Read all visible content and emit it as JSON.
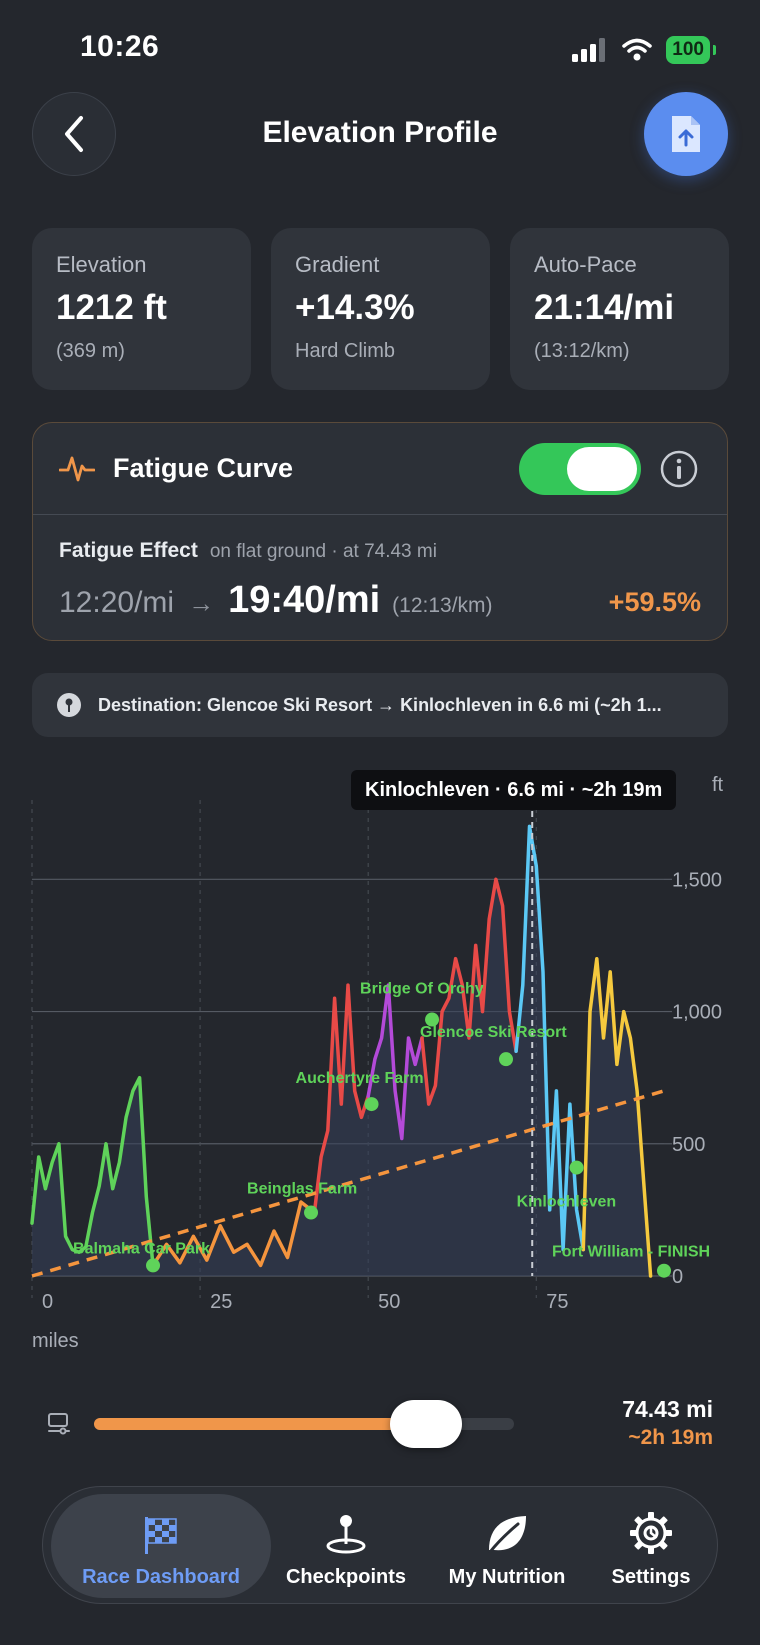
{
  "status": {
    "time": "10:26",
    "battery": "100"
  },
  "header": {
    "title": "Elevation Profile"
  },
  "stats": [
    {
      "label": "Elevation",
      "value": "1212 ft",
      "sub": "(369 m)"
    },
    {
      "label": "Gradient",
      "value": "+14.3%",
      "sub": "Hard Climb"
    },
    {
      "label": "Auto-Pace",
      "value": "21:14/mi",
      "sub": "(13:12/km)"
    }
  ],
  "fatigue": {
    "title": "Fatigue Curve",
    "enabled": true,
    "effect_label": "Fatigue Effect",
    "effect_note": "on flat ground · at 74.43 mi",
    "from_pace": "12:20/mi",
    "to_pace": "19:40/mi",
    "to_pace_km": "(12:13/km)",
    "increase": "+59.5%"
  },
  "destination": {
    "text": "Destination: Glencoe Ski Resort → Kinlochleven in 6.6 mi (~2h 1..."
  },
  "tooltip": "Kinlochleven · 6.6 mi · ~2h 19m",
  "chart_data": {
    "type": "line",
    "xlabel": "miles",
    "ylabel": "ft",
    "xlim": [
      0,
      94
    ],
    "ylim": [
      0,
      1800
    ],
    "x_ticks": [
      "0",
      "25",
      "50",
      "75"
    ],
    "y_ticks": [
      "1,500",
      "1,000",
      "500",
      "0"
    ],
    "cursor_x": 74.4,
    "series": [
      {
        "color": "#5fd35a",
        "x": [
          0,
          1,
          2,
          3,
          4,
          5,
          6,
          7,
          8,
          9,
          10,
          11,
          12,
          13,
          14,
          15,
          16,
          17,
          18
        ],
        "y": [
          200,
          450,
          330,
          430,
          500,
          150,
          100,
          90,
          110,
          240,
          340,
          500,
          330,
          430,
          600,
          700,
          750,
          300,
          40
        ]
      },
      {
        "color": "#f5953e",
        "x": [
          18,
          20,
          22,
          24,
          26,
          28,
          30,
          32,
          34,
          36,
          38,
          40,
          42
        ],
        "y": [
          40,
          120,
          50,
          150,
          60,
          190,
          90,
          120,
          40,
          170,
          70,
          280,
          240
        ]
      },
      {
        "color": "#e84a47",
        "x": [
          42,
          43,
          44,
          45,
          46,
          47,
          48,
          49,
          50
        ],
        "y": [
          240,
          450,
          550,
          1050,
          650,
          1100,
          700,
          600,
          680
        ]
      },
      {
        "color": "#b44ad8",
        "x": [
          50,
          51,
          52,
          53,
          54,
          55,
          56,
          57,
          58
        ],
        "y": [
          680,
          820,
          900,
          1100,
          700,
          520,
          900,
          800,
          900
        ]
      },
      {
        "color": "#e84a47",
        "x": [
          58,
          59,
          60,
          61,
          62,
          63,
          64,
          65,
          66,
          67,
          68,
          69,
          70,
          71,
          72
        ],
        "y": [
          900,
          650,
          720,
          1000,
          1050,
          1200,
          1100,
          900,
          1250,
          1000,
          1350,
          1500,
          1400,
          1000,
          850
        ]
      },
      {
        "color": "#5bc8f5",
        "x": [
          72,
          73,
          74,
          75,
          76,
          77,
          78,
          79,
          80,
          81,
          82
        ],
        "y": [
          850,
          1100,
          1700,
          1550,
          1150,
          250,
          700,
          100,
          650,
          250,
          100
        ]
      },
      {
        "color": "#f5c93e",
        "x": [
          82,
          83,
          84,
          85,
          86,
          87,
          88,
          89,
          90,
          91,
          92
        ],
        "y": [
          100,
          1000,
          1200,
          900,
          1150,
          800,
          1000,
          900,
          700,
          350,
          0
        ]
      }
    ],
    "trend": {
      "color": "#f5953e",
      "x": [
        0,
        94
      ],
      "y": [
        0,
        700
      ]
    },
    "checkpoints": [
      {
        "name": "Balmaha Car Park",
        "x": 18,
        "y": 40
      },
      {
        "name": "Beinglas Farm",
        "x": 41.5,
        "y": 240
      },
      {
        "name": "Auchertyre Farm",
        "x": 50.5,
        "y": 650
      },
      {
        "name": "Bridge Of Orchy",
        "x": 59.5,
        "y": 970
      },
      {
        "name": "Glencoe Ski Resort",
        "x": 70.5,
        "y": 820
      },
      {
        "name": "Kinlochleven",
        "x": 81,
        "y": 410
      },
      {
        "name": "Fort William - FINISH",
        "x": 94,
        "y": 20
      }
    ]
  },
  "slider": {
    "value_fraction": 0.79,
    "distance": "74.43 mi",
    "eta": "~2h 19m"
  },
  "tabs": [
    {
      "label": "Race Dashboard",
      "icon": "checkered-flag-icon",
      "active": true
    },
    {
      "label": "Checkpoints",
      "icon": "map-pin-icon",
      "active": false
    },
    {
      "label": "My Nutrition",
      "icon": "leaf-icon",
      "active": false
    },
    {
      "label": "Settings",
      "icon": "gear-icon",
      "active": false
    }
  ],
  "colors": {
    "accent": "#f0964a",
    "active_tab": "#6e9cf5",
    "toggle": "#34c759",
    "export": "#5b8def"
  }
}
